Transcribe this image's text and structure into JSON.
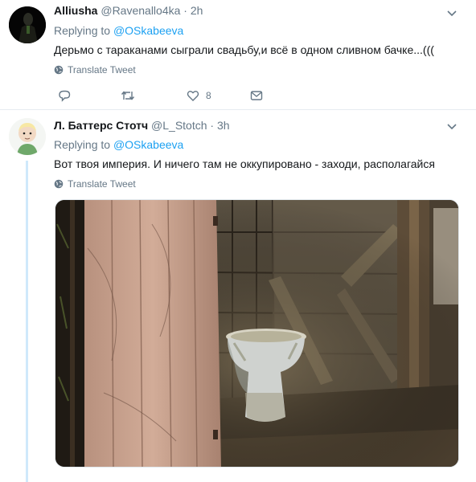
{
  "tweets": [
    {
      "name": "Alliusha",
      "handle": "@Ravenallo4ka",
      "time": "· 2h",
      "replying_prefix": "Replying to",
      "replying_to": "@OSkabeeva",
      "text": "Дерьмо с тараканами сыграли свадьбу,и всё в одном сливном бачке...(((",
      "translate": "Translate Tweet",
      "likes": "8",
      "icons": [
        "reply-icon",
        "retweet-icon",
        "like-icon",
        "message-icon",
        "globe-icon",
        "chevron-down-icon"
      ]
    },
    {
      "name": "Л. Баттерс Стотч",
      "handle": "@L_Stotch",
      "time": "· 3h",
      "replying_prefix": "Replying to",
      "replying_to": "@OSkabeeva",
      "text": "Вот твоя империя. И ничего там не оккупировано - заходи, располагайся",
      "translate": "Translate Tweet",
      "icons": [
        "globe-icon",
        "chevron-down-icon"
      ]
    }
  ],
  "colors": {
    "accent": "#1da1f2",
    "secondary_text": "#657786",
    "thread_line": "#cfe9fb",
    "divider": "#e6ecf0"
  }
}
